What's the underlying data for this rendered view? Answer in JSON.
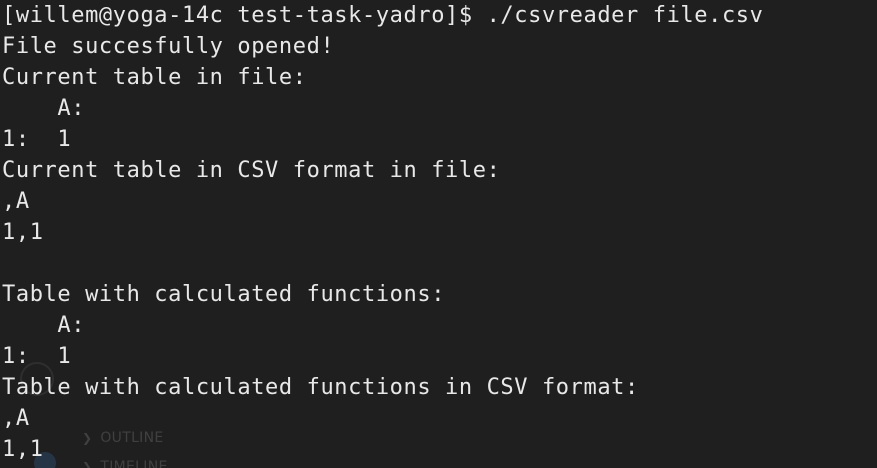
{
  "terminal": {
    "lines": [
      "[willem@yoga-14c test-task-yadro]$ ./csvreader file.csv",
      "File succesfully opened!",
      "Current table in file:",
      "    A:",
      "1:  1",
      "Current table in CSV format in file:",
      ",A",
      "1,1",
      "",
      "Table with calculated functions:",
      "    A:",
      "1:  1",
      "Table with calculated functions in CSV format:",
      ",A",
      "1,1"
    ]
  },
  "background_overlay": {
    "outline_label": "OUTLINE",
    "timeline_label": "TIMELINE",
    "chevron_icon": "chevron-right-icon"
  },
  "colors": {
    "background": "#1f1f1f",
    "text": "#e8e8e8"
  }
}
